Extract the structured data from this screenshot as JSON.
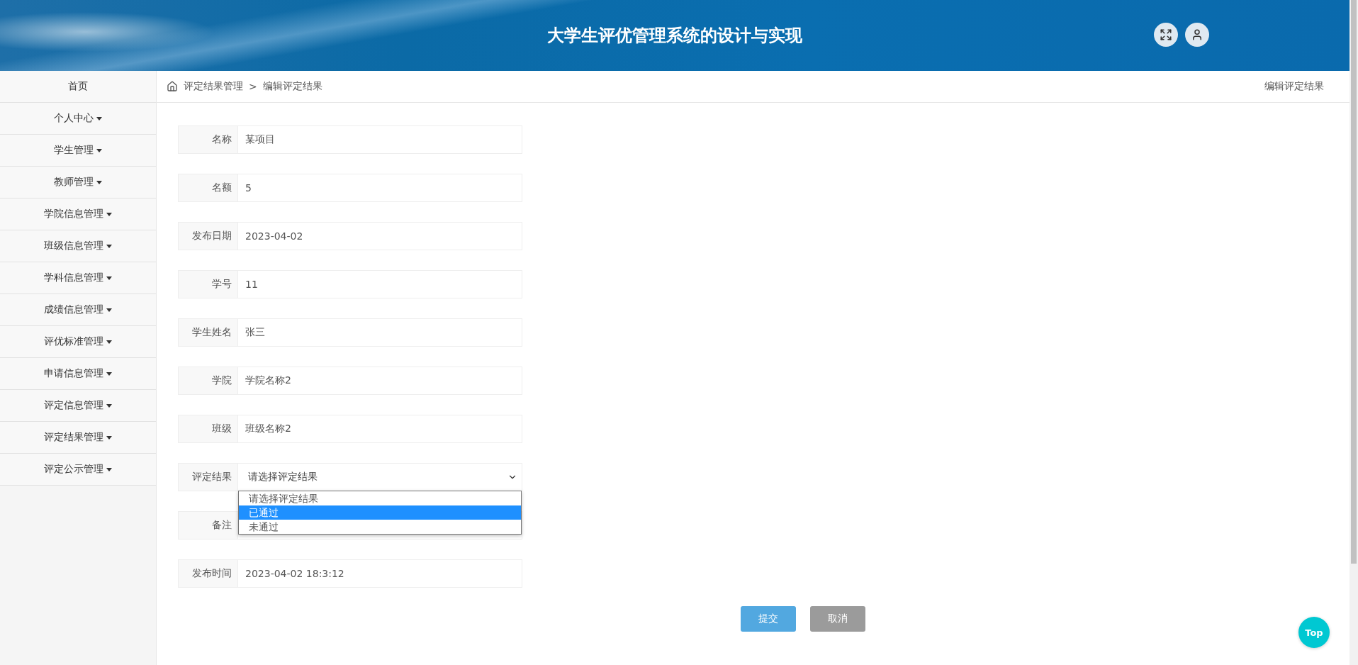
{
  "header": {
    "title": "大学生评优管理系统的设计与实现"
  },
  "sidebar": {
    "items": [
      {
        "label": "首页",
        "kind": "link"
      },
      {
        "label": "个人中心",
        "kind": "menu"
      },
      {
        "label": "学生管理",
        "kind": "menu"
      },
      {
        "label": "教师管理",
        "kind": "menu"
      },
      {
        "label": "学院信息管理",
        "kind": "menu"
      },
      {
        "label": "班级信息管理",
        "kind": "menu"
      },
      {
        "label": "学科信息管理",
        "kind": "menu"
      },
      {
        "label": "成绩信息管理",
        "kind": "menu"
      },
      {
        "label": "评优标准管理",
        "kind": "menu"
      },
      {
        "label": "申请信息管理",
        "kind": "menu"
      },
      {
        "label": "评定信息管理",
        "kind": "menu"
      },
      {
        "label": "评定结果管理",
        "kind": "menu"
      },
      {
        "label": "评定公示管理",
        "kind": "menu"
      }
    ]
  },
  "breadcrumb": {
    "items": [
      "评定结果管理",
      "编辑评定结果"
    ],
    "separator": ">",
    "page_title": "编辑评定结果"
  },
  "form": {
    "fields": [
      {
        "label": "名称",
        "kind": "text",
        "value": "某项目"
      },
      {
        "label": "名额",
        "kind": "text",
        "value": "5"
      },
      {
        "label": "发布日期",
        "kind": "text",
        "value": "2023-04-02"
      },
      {
        "label": "学号",
        "kind": "text",
        "value": "11"
      },
      {
        "label": "学生姓名",
        "kind": "text",
        "value": "张三"
      },
      {
        "label": "学院",
        "kind": "text",
        "value": "学院名称2"
      },
      {
        "label": "班级",
        "kind": "text",
        "value": "班级名称2"
      },
      {
        "label": "评定结果",
        "kind": "select",
        "value": "请选择评定结果",
        "expanded": true,
        "options": [
          {
            "label": "请选择评定结果",
            "highlighted": false
          },
          {
            "label": "已通过",
            "highlighted": true
          },
          {
            "label": "未通过",
            "highlighted": false
          }
        ]
      },
      {
        "label": "备注",
        "kind": "text"
      },
      {
        "label": "发布时间",
        "kind": "text",
        "value": "2023-04-02 18:3:12"
      }
    ],
    "buttons": [
      {
        "label": "提交",
        "kind": "primary"
      },
      {
        "label": "取消",
        "kind": "secondary"
      }
    ]
  },
  "top_button": {
    "label": "Top"
  }
}
